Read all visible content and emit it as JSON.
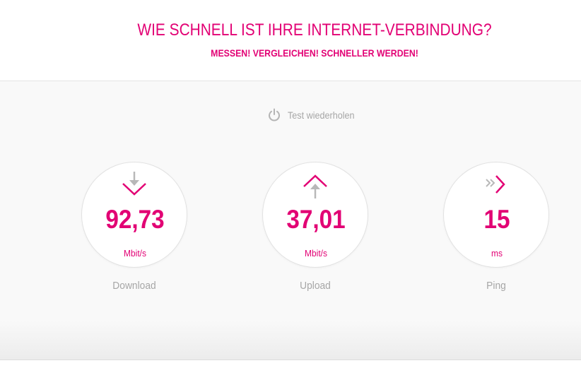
{
  "header": {
    "title": "WIE SCHNELL IST IHRE INTERNET-VERBINDUNG?",
    "subtitle": "MESSEN! VERGLEICHEN! SCHNELLER WERDEN!"
  },
  "retest": {
    "label": "Test wiederholen",
    "icon": "power-icon"
  },
  "metrics": [
    {
      "name": "download",
      "value": "92,73",
      "unit": "Mbit/s",
      "caption": "Download",
      "icon": "download-arrow-icon"
    },
    {
      "name": "upload",
      "value": "37,01",
      "unit": "Mbit/s",
      "caption": "Upload",
      "icon": "upload-arrow-icon"
    },
    {
      "name": "ping",
      "value": "15",
      "unit": "ms",
      "caption": "Ping",
      "icon": "ping-chevron-icon"
    }
  ],
  "colors": {
    "accent": "#e20074",
    "muted": "#a6a6a6",
    "icon_gray": "#b8b8b8",
    "background": "#f9f9f9"
  }
}
